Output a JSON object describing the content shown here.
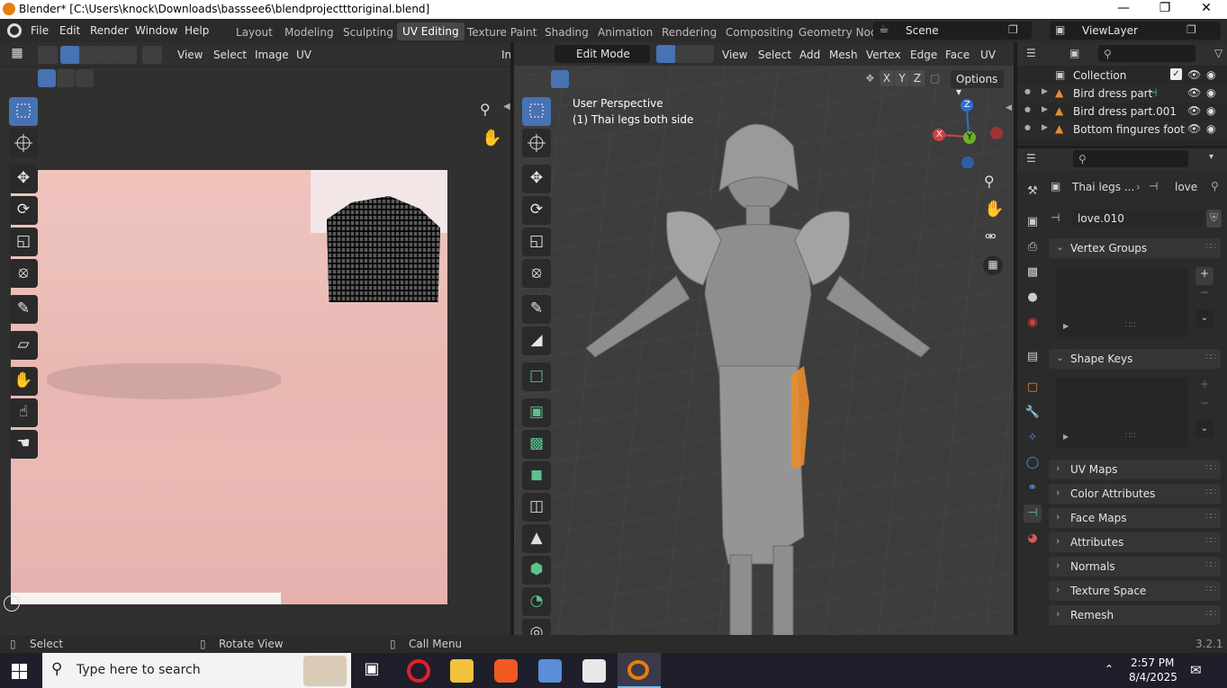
{
  "window": {
    "title": "Blender* [C:\\Users\\knock\\Downloads\\basssee6\\blendprojectttoriginal.blend]"
  },
  "menu": {
    "items": [
      "File",
      "Edit",
      "Render",
      "Window",
      "Help"
    ]
  },
  "workspaces": {
    "items": [
      "Layout",
      "Modeling",
      "Sculpting",
      "UV Editing",
      "Texture Paint",
      "Shading",
      "Animation",
      "Rendering",
      "Compositing",
      "Geometry Noc"
    ],
    "active": "UV Editing"
  },
  "scene": {
    "name": "Scene"
  },
  "view_layer": {
    "name": "ViewLayer"
  },
  "uv_editor": {
    "menus": [
      "View",
      "Select",
      "Image",
      "UV"
    ],
    "clipped_label": "In"
  },
  "viewport": {
    "mode": "Edit Mode",
    "menus": [
      "View",
      "Select",
      "Add",
      "Mesh",
      "Vertex",
      "Edge",
      "Face",
      "UV"
    ],
    "overlay_text_1": "User Perspective",
    "overlay_text_2": "(1) Thai legs both side",
    "axes": {
      "x": "X",
      "y": "Y",
      "z": "Z"
    },
    "options_label": "Options"
  },
  "outliner": {
    "root": "Collection",
    "items": [
      "Bird dress part",
      "Bird dress part.001",
      "Bottom fingures foot"
    ]
  },
  "properties": {
    "object_name": "Thai legs ...",
    "data_name": "love",
    "mesh_name": "love.010",
    "panels": [
      "Vertex Groups",
      "Shape Keys",
      "UV Maps",
      "Color Attributes",
      "Face Maps",
      "Attributes",
      "Normals",
      "Texture Space",
      "Remesh"
    ]
  },
  "status": {
    "select": "Select",
    "rotate": "Rotate View",
    "menu": "Call Menu",
    "version": "3.2.1"
  },
  "taskbar": {
    "search_placeholder": "Type here to search",
    "time": "2:57 PM",
    "date": "8/4/2025"
  },
  "colors": {
    "accent": "#4772b3",
    "bg": "#1d1d1d",
    "selected_mesh": "#ff8a1a"
  }
}
